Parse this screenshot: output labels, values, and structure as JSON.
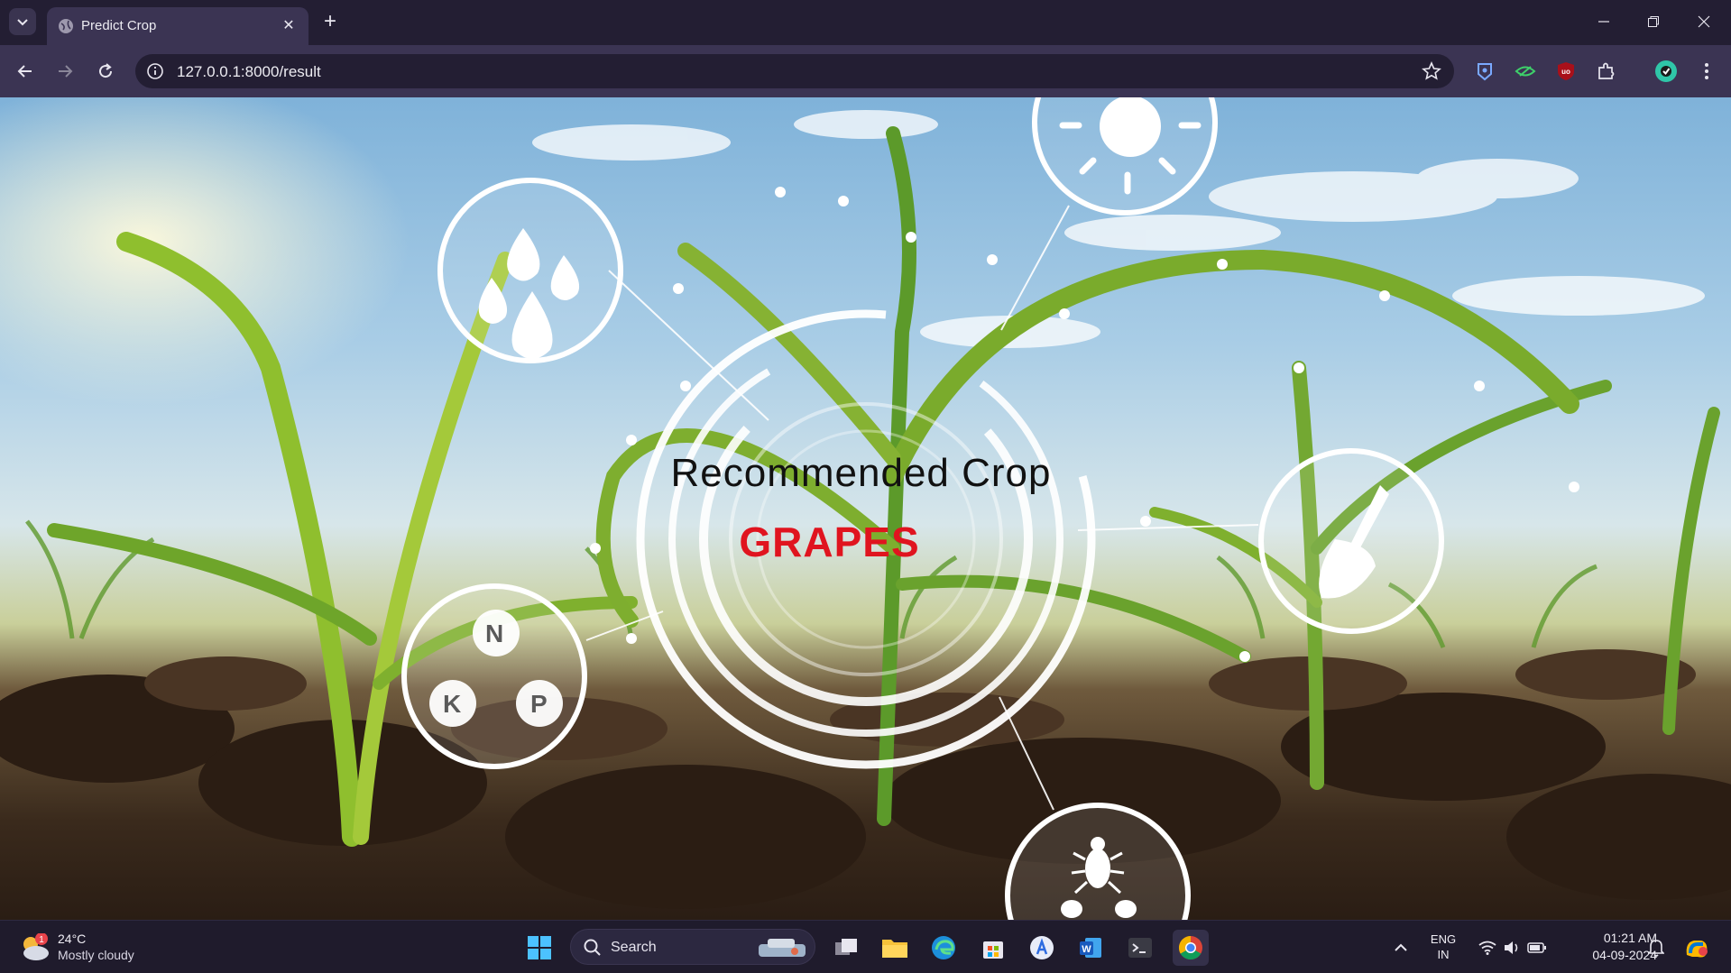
{
  "browser": {
    "tab_title": "Predict Crop",
    "url": "127.0.0.1:8000/result"
  },
  "page": {
    "heading": "Recommended Crop",
    "crop": "GRAPES",
    "crop_color": "#e0141f",
    "nutrient_labels": [
      "N",
      "K",
      "P"
    ]
  },
  "taskbar": {
    "weather_temp": "24°C",
    "weather_condition": "Mostly cloudy",
    "weather_badge": "1",
    "search_label": "Search",
    "lang_line1": "ENG",
    "lang_line2": "IN",
    "time": "01:21 AM",
    "date": "04-09-2024"
  }
}
